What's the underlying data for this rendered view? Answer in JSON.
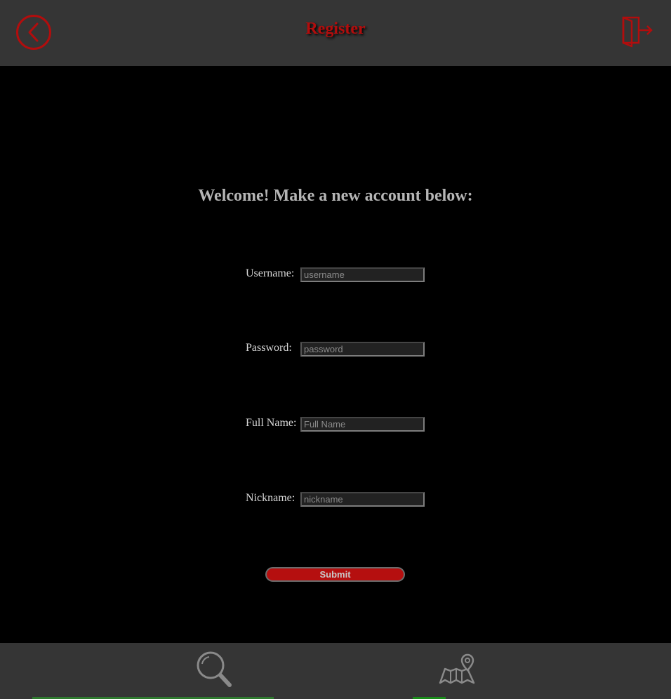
{
  "header": {
    "title": "Register",
    "back_icon": "back-arrow-icon",
    "logout_icon": "logout-door-icon",
    "accent_color": "#b20d0d"
  },
  "form": {
    "heading": "Welcome! Make a new account below:",
    "fields": [
      {
        "label": "Username:",
        "placeholder": "username",
        "value": ""
      },
      {
        "label": "Password:",
        "placeholder": "password",
        "value": ""
      },
      {
        "label": "Full Name:",
        "placeholder": "Full Name",
        "value": ""
      },
      {
        "label": "Nickname:",
        "placeholder": "nickname",
        "value": ""
      }
    ],
    "submit_label": "Submit"
  },
  "bottom_nav": {
    "items": [
      {
        "icon": "search-icon"
      },
      {
        "icon": "map-pin-icon"
      }
    ]
  }
}
